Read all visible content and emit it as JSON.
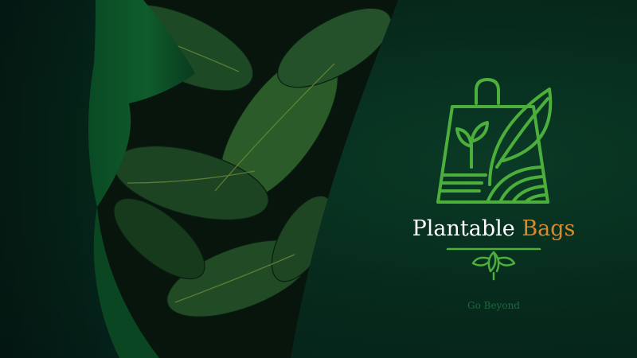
{
  "brand": {
    "name_primary": "Plantable",
    "name_secondary": "Bags",
    "tagline": "Go Beyond"
  },
  "colors": {
    "background": "#062a1b",
    "logo_green": "#4caf3c",
    "brand_white": "#ffffff",
    "brand_orange": "#d98a2b",
    "tagline_green": "#1b6a3f"
  },
  "icons": {
    "logo": "shopping-bag-leaf-icon",
    "ornament": "leaf-sprig-icon"
  }
}
